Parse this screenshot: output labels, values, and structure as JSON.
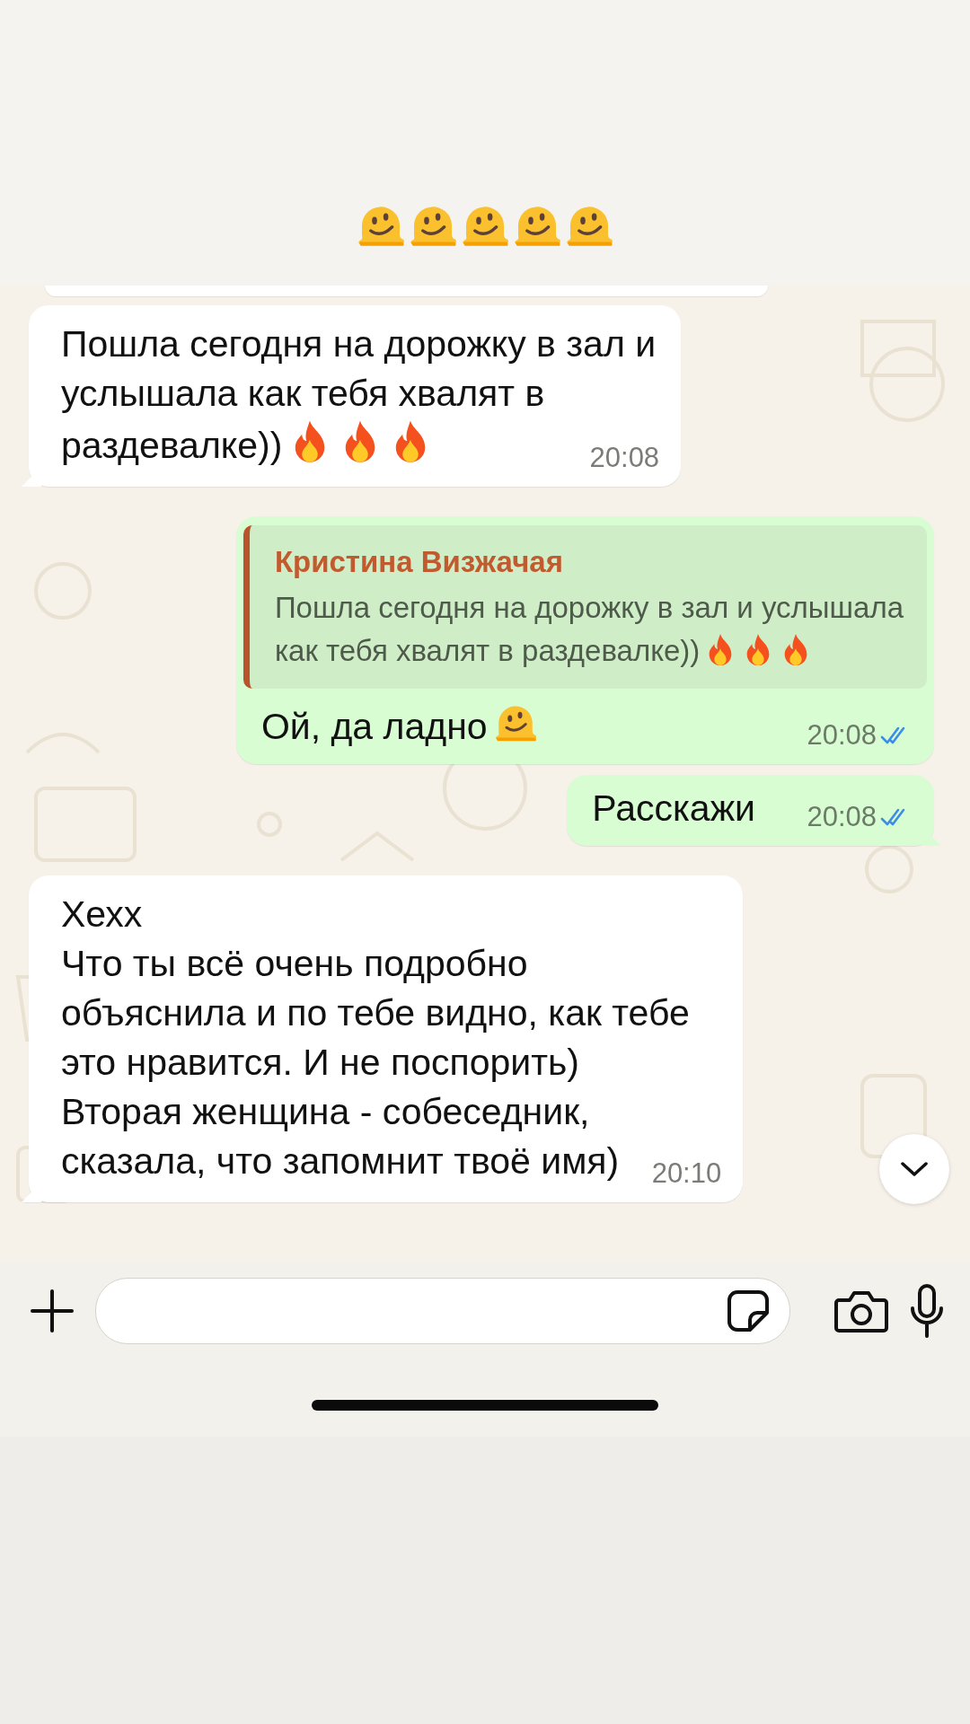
{
  "caption": {
    "icons": [
      {
        "kind": "melting-face"
      },
      {
        "kind": "melting-face"
      },
      {
        "kind": "melting-face"
      },
      {
        "kind": "melting-face"
      },
      {
        "kind": "melting-face"
      }
    ]
  },
  "chat": {
    "messages": [
      {
        "kind": "cut-off",
        "outgoing": false
      },
      {
        "kind": "text",
        "outgoing": false,
        "lines": [
          "Пошла сегодня на дорожку в зал и",
          "услышала как тебя хвалят в",
          "раздевалке))"
        ],
        "icons": [
          {
            "kind": "flame"
          },
          {
            "kind": "flame"
          },
          {
            "kind": "flame"
          }
        ],
        "time": "20:08",
        "tail": true
      },
      {
        "kind": "reply",
        "outgoing": true,
        "quote": {
          "author": "Кристина Визжачая",
          "lines": [
            "Пошла сегодня на дорожку в зал и услышала",
            "как тебя хвалят в раздевалке))"
          ],
          "icons": [
            {
              "kind": "flame"
            },
            {
              "kind": "flame"
            },
            {
              "kind": "flame"
            }
          ]
        },
        "lines": [
          "Ой, да ладно"
        ],
        "icons": [
          {
            "kind": "melting-face"
          }
        ],
        "time": "20:08",
        "read": true,
        "tail": false
      },
      {
        "kind": "text",
        "outgoing": true,
        "lines": [
          "Расскажи"
        ],
        "time": "20:08",
        "read": true,
        "tail": true
      },
      {
        "kind": "text",
        "outgoing": false,
        "lines": [
          "Хехх",
          "Что ты всё очень подробно",
          "объяснила и по тебе видно, как тебе",
          "это нравится. И не поспорить)",
          "Вторая женщина - собеседник,",
          "сказала, что запомнит твоё имя)"
        ],
        "time": "20:10",
        "tail": true
      }
    ]
  }
}
